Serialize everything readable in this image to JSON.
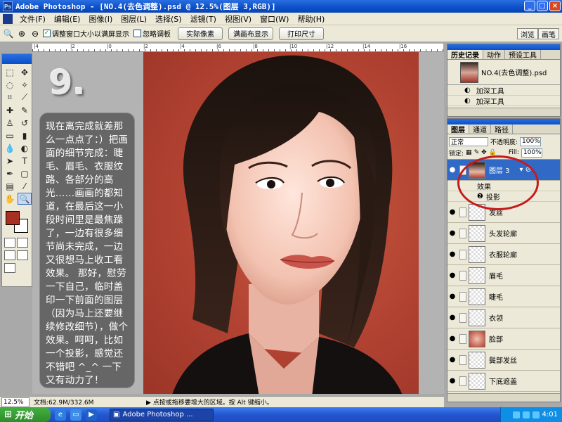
{
  "window": {
    "title": "Adobe Photoshop - [NO.4(去色调整).psd @ 12.5%(图层 3,RGB)]",
    "btn_min": "_",
    "btn_max": "□",
    "btn_close": "×"
  },
  "menu": [
    "文件(F)",
    "编辑(E)",
    "图像(I)",
    "图层(L)",
    "选择(S)",
    "滤镜(T)",
    "视图(V)",
    "窗口(W)",
    "帮助(H)"
  ],
  "options": {
    "zoom_in": "⊕",
    "zoom_out": "⊖",
    "resize_windows_label": "调整窗口大小以满屏显示",
    "resize_windows_checked": true,
    "ignore_palettes_label": "忽略调板",
    "ignore_palettes_checked": false,
    "actual_pixels": "实际像素",
    "fit_on_screen": "满画布显示",
    "print_size": "打印尺寸"
  },
  "palette_well": {
    "tab1": "浏览",
    "tab2": "画笔"
  },
  "ruler_labels": [
    "|4",
    "|2",
    "|0",
    "|2",
    "|4",
    "|6",
    "|8",
    "|10",
    "|12",
    "|14",
    "|16"
  ],
  "tutorial": {
    "step": "9.",
    "text": "现在离完成就差那么一点点了：）把画面的细节完成：睫毛、眉毛、衣服纹路、各部分的高光……画画的都知道，在最后这一小段时间里是最焦躁了，一边有很多细节尚未完成，一边又很想马上收工看效果。 那好，慰劳一下自己，临时盖印一下前面的图层（因为马上还要继续修改细节），做个效果。呵呵，比如一个投影，感觉还不错吧 ^_^ 一下又有动力了！"
  },
  "status": {
    "zoom": "12.5%",
    "doc": "文档:62.9M/332.6M",
    "hint": "▶ 点按或拖移要增大的区域。按 Alt 键缩小。"
  },
  "history": {
    "tabs": [
      "历史记录",
      "动作",
      "预设工具"
    ],
    "snapshot": "NO.4(去色调整).psd",
    "items": [
      "加深工具",
      "加深工具"
    ]
  },
  "layers": {
    "tabs": [
      "图层",
      "通道",
      "路径"
    ],
    "blend_mode": "正常",
    "opacity_label": "不透明度:",
    "opacity": "100%",
    "lock_label": "锁定:",
    "fill_label": "Fill:",
    "fill": "100%",
    "active_layer": "图层 3",
    "effects_label": "效果",
    "drop_shadow_label": "投影",
    "list": [
      "发丝",
      "头发轮廓",
      "衣服轮廓",
      "眉毛",
      "睫毛",
      "衣领",
      "脸部",
      "鬓部发丝",
      "下底遮盖"
    ]
  },
  "taskbar": {
    "start": "开始",
    "task": "Adobe Photoshop ...",
    "clock": "4:01"
  }
}
